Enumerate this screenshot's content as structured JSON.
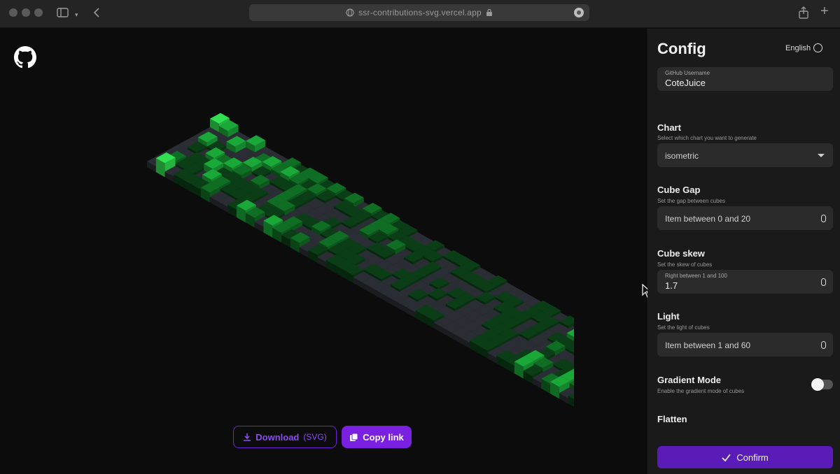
{
  "browser": {
    "url": "ssr-contributions-svg.vercel.app"
  },
  "icons": {
    "github": "github-icon",
    "download": "download-icon",
    "copy": "copy-icon",
    "check": "check-icon",
    "lock": "lock-icon",
    "globe": "globe-icon"
  },
  "colors": {
    "accent": "#7a20e0",
    "confirm": "#5a1bb8",
    "cube_empty": "#2a2d33",
    "cube_l1": "#0b3d16",
    "cube_l2": "#106d24",
    "cube_l3": "#1aa838",
    "cube_l4": "#30e050"
  },
  "actions": {
    "download_label": "Download",
    "download_format": "(SVG)",
    "copy_label": "Copy link"
  },
  "config": {
    "title": "Config",
    "language": "English",
    "username": {
      "label": "GitHub Username",
      "value": "CoteJuice"
    },
    "chart": {
      "heading": "Chart",
      "description": "Select which chart you want to generate",
      "value": "isometric"
    },
    "cube_gap": {
      "heading": "Cube Gap",
      "description": "Set the gap between cubes",
      "placeholder": "Item between 0 and 20"
    },
    "cube_skew": {
      "heading": "Cube skew",
      "description": "Set the skew of cubes",
      "label": "Right between 1 and 100",
      "value": "1.7"
    },
    "light": {
      "heading": "Light",
      "description": "Set the light of cubes",
      "placeholder": "Item between 1 and 60"
    },
    "gradient_mode": {
      "heading": "Gradient Mode",
      "description": "Enable the gradient mode of cubes",
      "enabled": false
    },
    "flatten": {
      "heading": "Flatten"
    },
    "confirm_label": "Confirm"
  }
}
